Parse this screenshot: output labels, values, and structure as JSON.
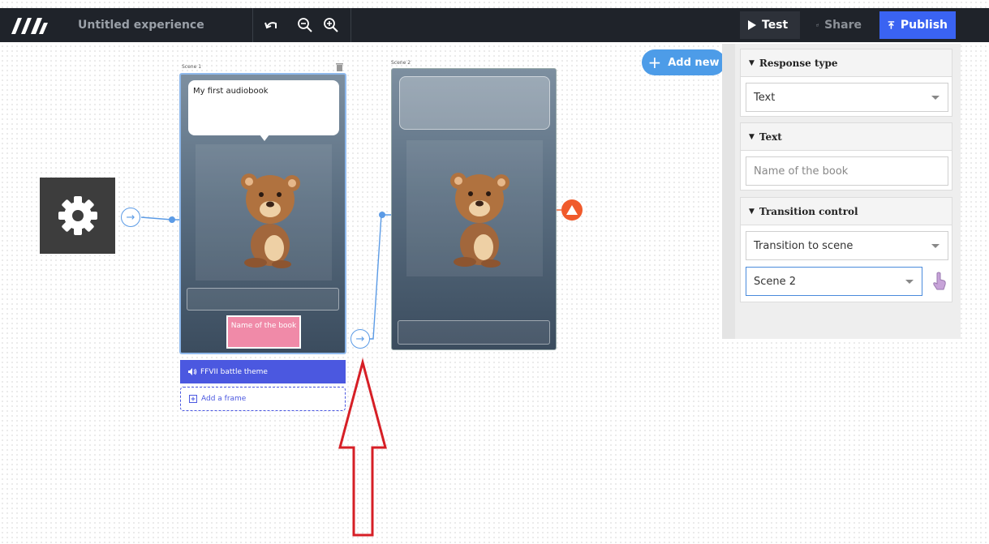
{
  "header": {
    "title": "Untitled experience",
    "test_label": "Test",
    "share_label": "Share",
    "publish_label": "Publish"
  },
  "canvas": {
    "add_new_label": "Add new",
    "scene1": {
      "label": "Scene 1",
      "bubble_text": "My first audiobook",
      "button_text": "Name of the book",
      "audio_label": "FFVII battle theme",
      "add_frame_label": "Add a frame"
    },
    "scene2": {
      "label": "Scene 2"
    }
  },
  "panel": {
    "response_type": {
      "title": "Response type",
      "value": "Text"
    },
    "text": {
      "title": "Text",
      "placeholder": "Name of the book"
    },
    "transition": {
      "title": "Transition control",
      "mode": "Transition to scene",
      "target": "Scene 2"
    }
  },
  "colors": {
    "accent": "#3a63f2",
    "link": "#5b9be6",
    "audio": "#4b58e0",
    "warning": "#f05a2b",
    "button_pink": "#f08aa8",
    "annotation_arrow": "#d61f26"
  }
}
